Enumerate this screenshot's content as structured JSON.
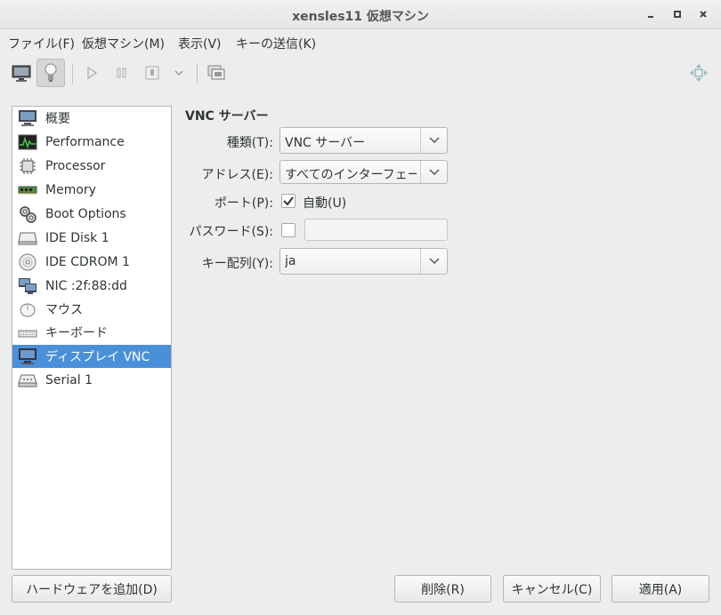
{
  "window": {
    "title": "xensles11 仮想マシン",
    "minimize": "‐",
    "maximize": "▫",
    "close": "×"
  },
  "menubar": {
    "items": [
      "ファイル(F)",
      "仮想マシン(M)",
      "表示(V)",
      "キーの送信(K)"
    ]
  },
  "toolbar": {
    "icons": [
      "console-icon",
      "details-lightbulb-icon",
      "run-icon",
      "pause-icon",
      "shutdown-icon",
      "shutdown-menu-icon",
      "snapshot-icon",
      "fullscreen-icon"
    ]
  },
  "hardware": {
    "items": [
      {
        "label": "概要",
        "icon": "overview-icon"
      },
      {
        "label": "Performance",
        "icon": "performance-icon"
      },
      {
        "label": "Processor",
        "icon": "processor-icon"
      },
      {
        "label": "Memory",
        "icon": "memory-icon"
      },
      {
        "label": "Boot Options",
        "icon": "boot-options-icon"
      },
      {
        "label": "IDE Disk 1",
        "icon": "disk-icon"
      },
      {
        "label": "IDE CDROM 1",
        "icon": "cdrom-icon"
      },
      {
        "label": "NIC :2f:88:dd",
        "icon": "nic-icon"
      },
      {
        "label": "マウス",
        "icon": "mouse-icon"
      },
      {
        "label": "キーボード",
        "icon": "keyboard-icon"
      },
      {
        "label": "ディスプレイ VNC",
        "icon": "display-icon"
      },
      {
        "label": "Serial 1",
        "icon": "serial-icon"
      }
    ],
    "selected": "ディスプレイ VNC",
    "add_button": "ハードウェアを追加(D)"
  },
  "details": {
    "section_title": "VNC サーバー",
    "type_label": "種類(T):",
    "type_value": "VNC サーバー",
    "address_label": "アドレス(E):",
    "address_value": "すべてのインターフェース",
    "port_label": "ポート(P):",
    "port_auto_label": "自動(U)",
    "port_auto_checked": true,
    "password_label": "パスワード(S):",
    "password_checked": false,
    "password_value": "",
    "keymap_label": "キー配列(Y):",
    "keymap_value": "ja"
  },
  "buttons": {
    "remove": "削除(R)",
    "cancel": "キャンセル(C)",
    "apply": "適用(A)"
  },
  "colors": {
    "selection": "#4a90d9",
    "background": "#ededed"
  }
}
